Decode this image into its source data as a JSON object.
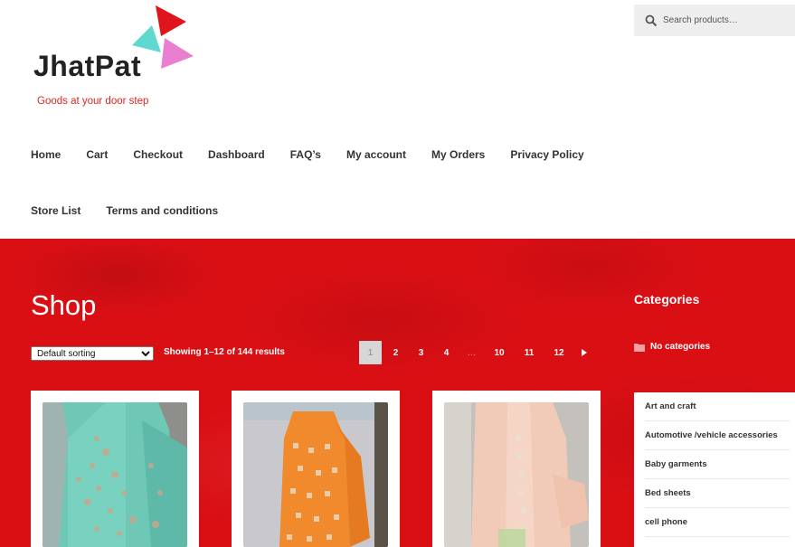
{
  "brand": {
    "name": "JhatPat",
    "tagline": "Goods at your door step",
    "colors": {
      "teal": "#5fd8d0",
      "red": "#e0141c",
      "pink": "#e97fd0"
    }
  },
  "search": {
    "placeholder": "Search products…",
    "icon": "search-icon"
  },
  "nav": {
    "items": [
      "Home",
      "Cart",
      "Checkout",
      "Dashboard",
      "FAQ’s",
      "My account",
      "My Orders",
      "Privacy Policy",
      "Store List",
      "Terms and conditions"
    ]
  },
  "hero": {
    "background": "#d90f14"
  },
  "shop": {
    "title": "Shop",
    "sorting": {
      "selected": "Default sorting"
    },
    "result_count": "Showing 1–12 of 144 results",
    "pagination": {
      "current": "1",
      "pages": [
        "2",
        "3",
        "4"
      ],
      "ellipsis": "…",
      "tail": [
        "10",
        "11",
        "12"
      ],
      "next_icon": "chevron-right-icon"
    }
  },
  "products": [
    {
      "image": "green embroidered dress"
    },
    {
      "image": "orange patterned dress"
    },
    {
      "image": "peach embroidered dress"
    }
  ],
  "sidebar": {
    "title": "Categories",
    "no_categories": "No categories",
    "categories": [
      "Art and craft",
      "Automotive /vehicle accessories",
      "Baby garments",
      "Bed sheets",
      "cell phone"
    ]
  }
}
